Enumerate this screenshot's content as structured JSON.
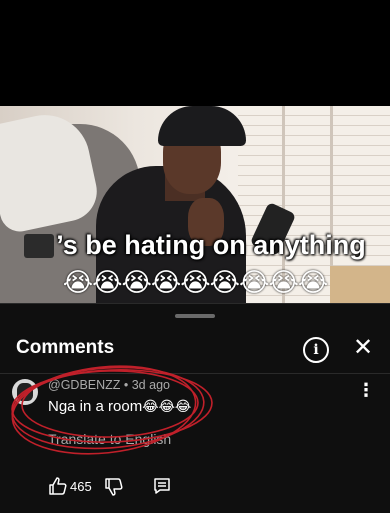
{
  "video": {
    "caption": "’s be hating on anything",
    "emoji_row": "😭😭😭😭😭😭😭😭😭"
  },
  "comments_panel": {
    "title": "Comments",
    "info_icon": "info-icon",
    "close_icon": "close-icon"
  },
  "comment": {
    "author": "@GDBENZZ",
    "time": "3d ago",
    "meta": "@GDBENZZ • 3d ago",
    "text": "Nga in a room",
    "emojis": "😂😂😂",
    "translate_label": "Translate to English",
    "like_count": "465",
    "scribble_color": "#c0202a"
  }
}
